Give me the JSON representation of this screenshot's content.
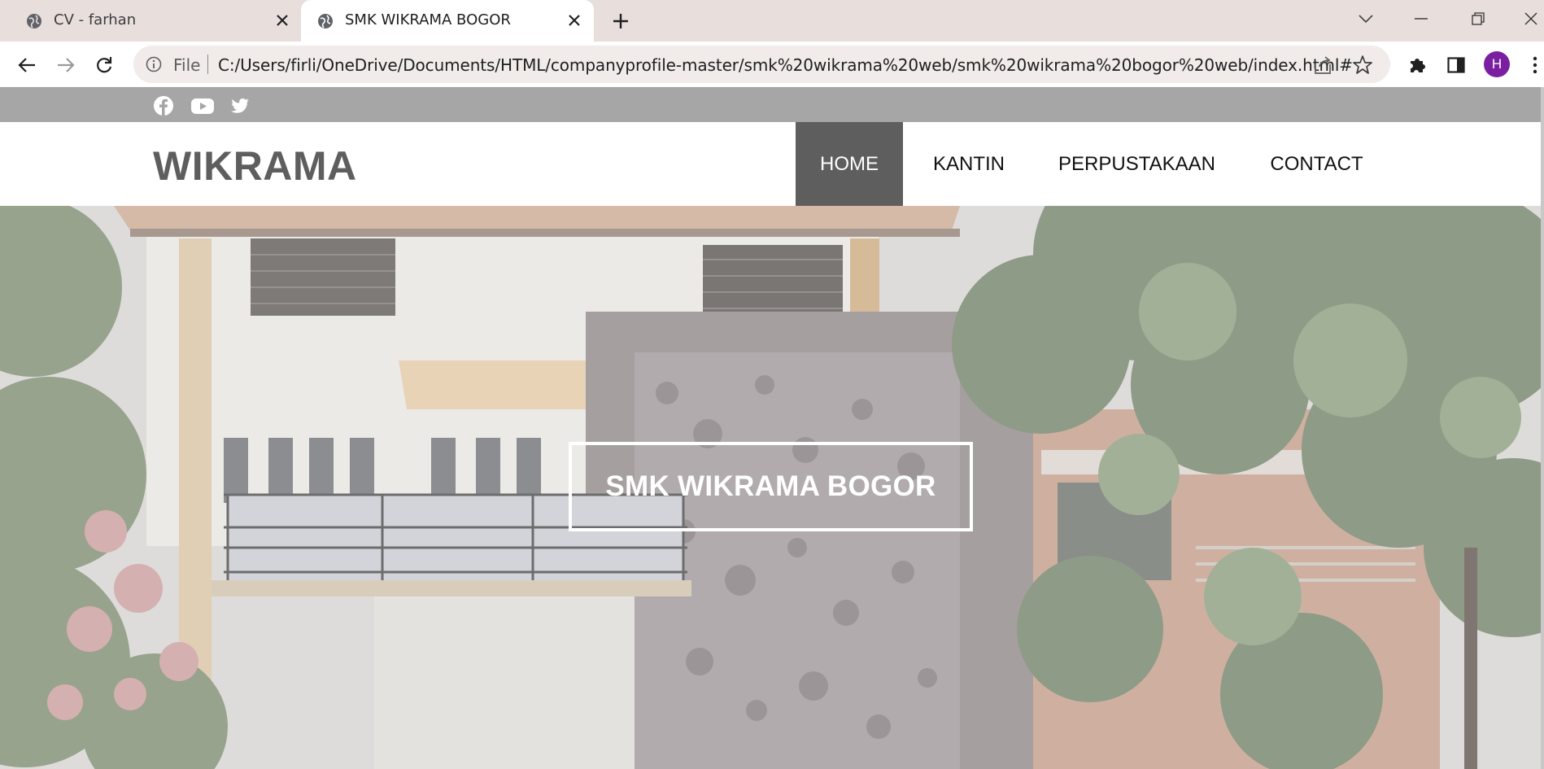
{
  "browser": {
    "tabs": [
      {
        "title": "CV - farhan",
        "active": false
      },
      {
        "title": "SMK WIKRAMA BOGOR",
        "active": true
      }
    ],
    "address": {
      "scheme_label": "File",
      "url": "C:/Users/firli/OneDrive/Documents/HTML/companyprofile-master/smk%20wikrama%20web/smk%20wikrama%20bogor%20web/index.html#"
    },
    "profile_initial": "H",
    "profile_color": "#7b1fa2"
  },
  "site": {
    "social": [
      "facebook-icon",
      "youtube-icon",
      "twitter-icon"
    ],
    "logo": "WIKRAMA",
    "nav": [
      {
        "label": "HOME",
        "active": true
      },
      {
        "label": "KANTIN",
        "active": false
      },
      {
        "label": "PERPUSTAKAAN",
        "active": false
      },
      {
        "label": "CONTACT",
        "active": false
      }
    ],
    "hero_title": "SMK WIKRAMA BOGOR"
  },
  "colors": {
    "topbar": "#a6a6a6",
    "nav_active_bg": "#5e5e5e",
    "logo": "#5e5e5e"
  }
}
